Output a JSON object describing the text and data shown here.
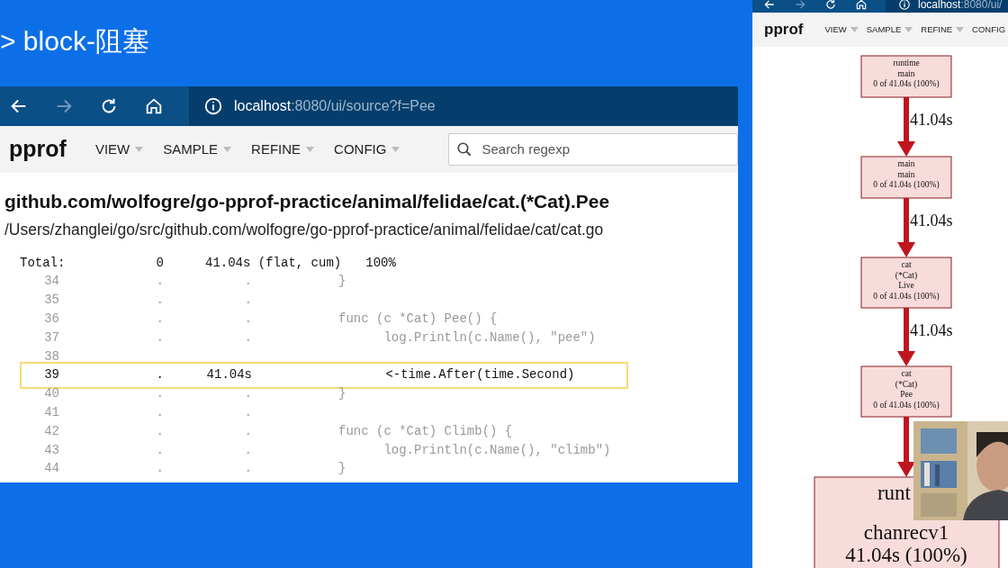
{
  "slide": {
    "title": "> block-阻塞"
  },
  "left_window": {
    "url_host": "localhost",
    "url_path": ":8080/ui/source?f=Pee",
    "app_name": "pprof",
    "menus": [
      "VIEW",
      "SAMPLE",
      "REFINE",
      "CONFIG"
    ],
    "search": {
      "placeholder": "Search regexp"
    },
    "function_title": "github.com/wolfogre/go-pprof-practice/animal/felidae/cat.(*Cat).Pee",
    "file_path": "/Users/zhanglei/go/src/github.com/wolfogre/go-pprof-practice/animal/felidae/cat/cat.go",
    "totals": {
      "label": "Total:",
      "flat": "0",
      "cum": "41.04s (flat, cum)",
      "percent": "100%"
    },
    "rows": [
      {
        "line": "34",
        "flat": ".",
        "cum": ".",
        "code": "}",
        "highlighted": false
      },
      {
        "line": "35",
        "flat": ".",
        "cum": ".",
        "highlighted": false
      },
      {
        "line": "36",
        "flat": ".",
        "cum": ".",
        "code": "func (c *Cat) Pee() {",
        "highlighted": false
      },
      {
        "line": "37",
        "flat": ".",
        "cum": ".",
        "code": "      log.Println(c.Name(), \"pee\")",
        "highlighted": false
      },
      {
        "line": "38",
        "highlighted": false
      },
      {
        "line": "39",
        "flat": ".",
        "cum": "41.04s",
        "code": "      <-time.After(time.Second)",
        "highlighted": true
      },
      {
        "line": "40",
        "flat": ".",
        "cum": ".",
        "code": "}",
        "highlighted": false
      },
      {
        "line": "41",
        "flat": ".",
        "cum": ".",
        "highlighted": false
      },
      {
        "line": "42",
        "flat": ".",
        "cum": ".",
        "code": "func (c *Cat) Climb() {",
        "highlighted": false
      },
      {
        "line": "43",
        "flat": ".",
        "cum": ".",
        "code": "      log.Println(c.Name(), \"climb\")",
        "highlighted": false
      },
      {
        "line": "44",
        "flat": ".",
        "cum": ".",
        "code": "}",
        "highlighted": false
      }
    ]
  },
  "right_window": {
    "url_host": "localhost",
    "url_path": ":8080/ui/",
    "app_name": "pprof",
    "menus": [
      "VIEW",
      "SAMPLE",
      "REFINE",
      "CONFIG"
    ],
    "graph": {
      "nodes": [
        {
          "kind": "small",
          "lines": [
            "runtime",
            "main",
            "0 of 41.04s (100%)"
          ]
        },
        {
          "kind": "small",
          "lines": [
            "main",
            "main",
            "0 of 41.04s (100%)"
          ]
        },
        {
          "kind": "small",
          "lines": [
            "cat",
            "(*Cat)",
            "Live",
            "0 of 41.04s (100%)"
          ]
        },
        {
          "kind": "small",
          "lines": [
            "cat",
            "(*Cat)",
            "Pee",
            "0 of 41.04s (100%)"
          ]
        },
        {
          "kind": "large",
          "lines": [
            "runt",
            "chanrecv1",
            "41.04s (100%)"
          ]
        }
      ],
      "edges": [
        {
          "label": "41.04s"
        },
        {
          "label": "41.04s"
        },
        {
          "label": "41.04s"
        }
      ]
    },
    "camera": {
      "kind": "picture"
    }
  }
}
